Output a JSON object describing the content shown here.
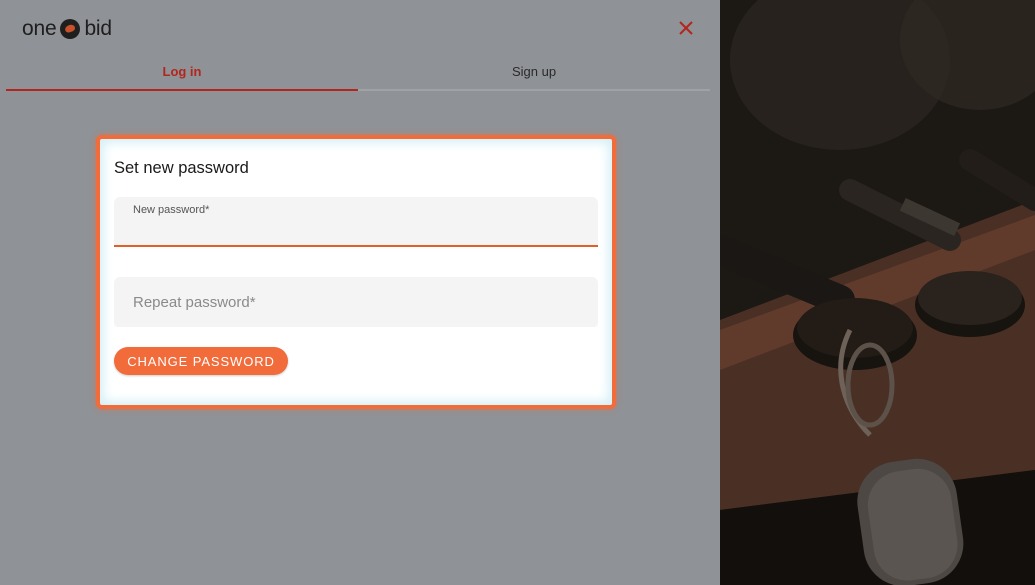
{
  "brand": {
    "logo_text_left": "one",
    "logo_text_right": "bid"
  },
  "icons": {
    "close": "close-icon",
    "logo_mark": "auction-hammer-icon"
  },
  "tabs": {
    "login": "Log in",
    "signup": "Sign up",
    "active": "login"
  },
  "form": {
    "title": "Set new password",
    "new_password_label": "New password*",
    "repeat_password_label": "Repeat password*",
    "submit_label": "CHANGE PASSWORD"
  },
  "colors": {
    "accent": "#f26b3a",
    "active_tab": "#b3261e",
    "overlay": "#8f9296"
  }
}
